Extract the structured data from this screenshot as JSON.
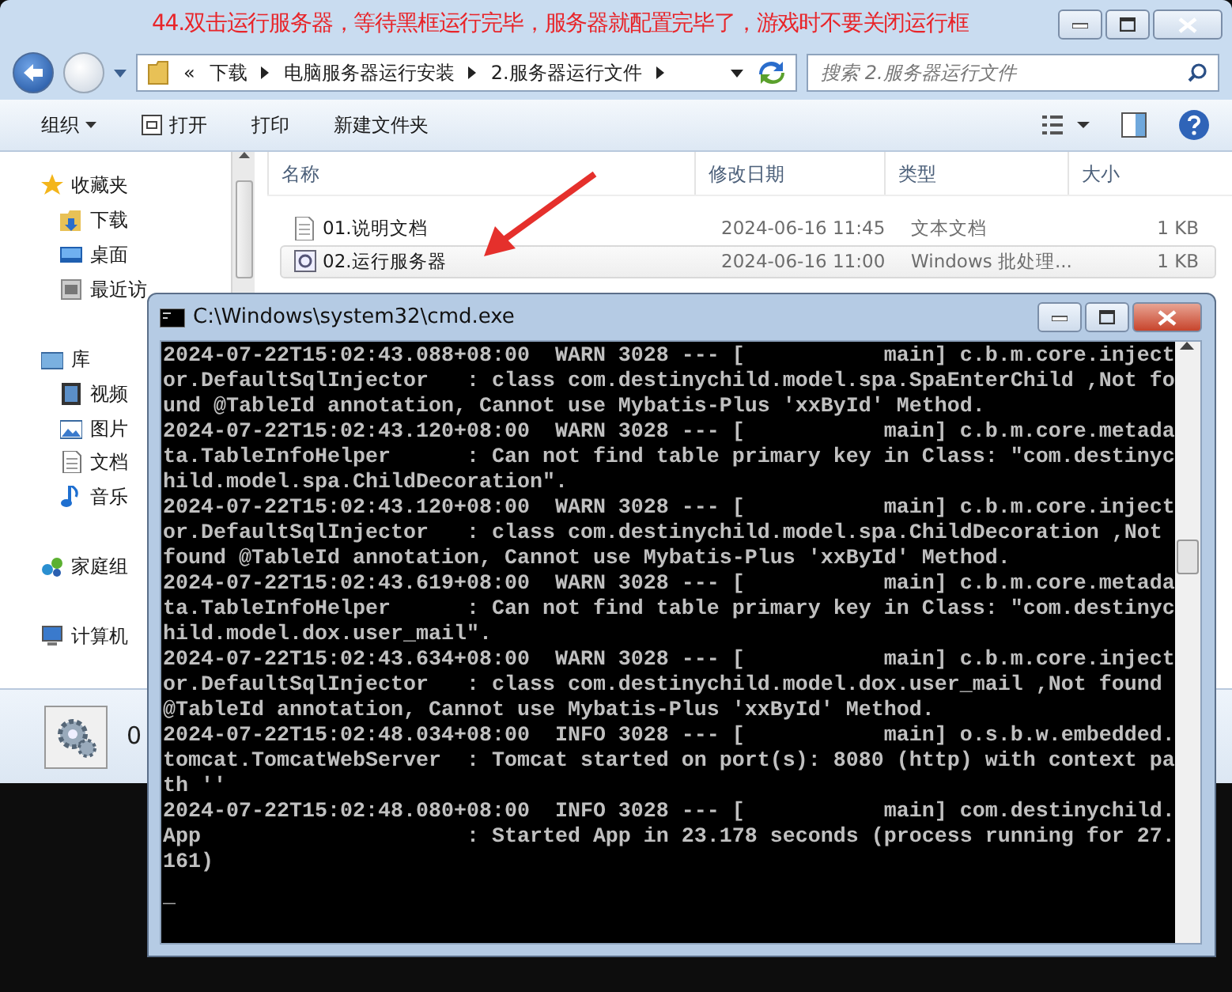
{
  "annotation": "44.双击运行服务器，等待黑框运行完毕，服务器就配置完毕了，游戏时不要关闭运行框",
  "explorer": {
    "breadcrumbs": [
      "«",
      "下载",
      "电脑服务器运行安装",
      "2.服务器运行文件"
    ],
    "search": {
      "placeholder": "搜索 2.服务器运行文件"
    },
    "toolbar": [
      {
        "label": "组织",
        "kind": "menu"
      },
      {
        "label": "打开",
        "kind": "icon"
      },
      {
        "label": "打印",
        "kind": "plain"
      },
      {
        "label": "新建文件夹",
        "kind": "plain"
      }
    ],
    "sidebar": [
      {
        "label": "收藏夹",
        "children": [
          {
            "label": "下载"
          },
          {
            "label": "桌面"
          },
          {
            "label": "最近访"
          }
        ]
      },
      {
        "label": "库",
        "children": [
          {
            "label": "视频"
          },
          {
            "label": "图片"
          },
          {
            "label": "文档"
          },
          {
            "label": "音乐"
          }
        ]
      },
      {
        "label": "家庭组"
      },
      {
        "label": "计算机"
      }
    ],
    "columns": [
      "名称",
      "修改日期",
      "类型",
      "大小"
    ],
    "rows": [
      {
        "name": "01.说明文档",
        "date": "2024-06-16 11:45",
        "type": "文本文档",
        "size": "1 KB",
        "selected": false
      },
      {
        "name": "02.运行服务器",
        "date": "2024-06-16 11:00",
        "type": "Windows 批处理...",
        "size": "1 KB",
        "selected": true
      }
    ],
    "details": {
      "name": "0"
    }
  },
  "console": {
    "title": "C:\\Windows\\system32\\cmd.exe",
    "lines": [
      "2024-07-22T15:02:43.088+08:00  WARN 3028 --- [           main] c.b.m.core.inject",
      "or.DefaultSqlInjector   : class com.destinychild.model.spa.SpaEnterChild ,Not fo",
      "und @TableId annotation, Cannot use Mybatis-Plus 'xxById' Method.",
      "2024-07-22T15:02:43.120+08:00  WARN 3028 --- [           main] c.b.m.core.metada",
      "ta.TableInfoHelper      : Can not find table primary key in Class: \"com.destinyc",
      "hild.model.spa.ChildDecoration\".",
      "2024-07-22T15:02:43.120+08:00  WARN 3028 --- [           main] c.b.m.core.inject",
      "or.DefaultSqlInjector   : class com.destinychild.model.spa.ChildDecoration ,Not",
      "found @TableId annotation, Cannot use Mybatis-Plus 'xxById' Method.",
      "2024-07-22T15:02:43.619+08:00  WARN 3028 --- [           main] c.b.m.core.metada",
      "ta.TableInfoHelper      : Can not find table primary key in Class: \"com.destinyc",
      "hild.model.dox.user_mail\".",
      "2024-07-22T15:02:43.634+08:00  WARN 3028 --- [           main] c.b.m.core.inject",
      "or.DefaultSqlInjector   : class com.destinychild.model.dox.user_mail ,Not found",
      "@TableId annotation, Cannot use Mybatis-Plus 'xxById' Method.",
      "2024-07-22T15:02:48.034+08:00  INFO 3028 --- [           main] o.s.b.w.embedded.",
      "tomcat.TomcatWebServer  : Tomcat started on port(s): 8080 (http) with context pa",
      "th ''",
      "2024-07-22T15:02:48.080+08:00  INFO 3028 --- [           main] com.destinychild.",
      "App                     : Started App in 23.178 seconds (process running for 27.",
      "161)"
    ],
    "cursor": "_"
  }
}
